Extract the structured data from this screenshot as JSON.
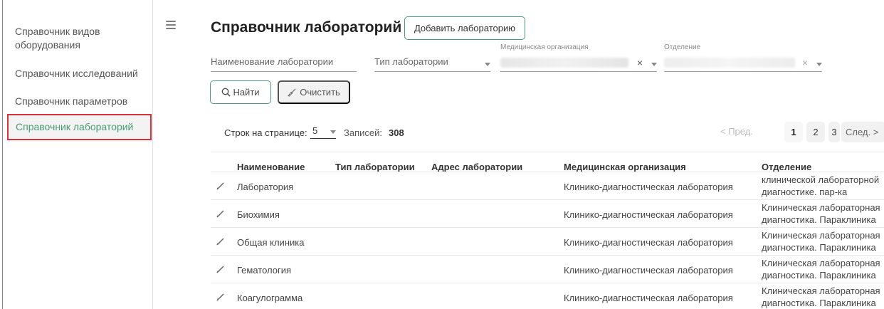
{
  "sidebar": {
    "items": [
      {
        "label": "Справочник видов\nоборудования"
      },
      {
        "label": "Справочник исследований"
      },
      {
        "label": "Справочник параметров"
      },
      {
        "label": "Справочник лабораторий"
      }
    ]
  },
  "header": {
    "title": "Справочник лабораторий",
    "add_button": "Добавить лабораторию"
  },
  "filters": {
    "name_placeholder": "Наименование лаборатории",
    "type_placeholder": "Тип лаборатории",
    "org_label": "Медицинская организация",
    "dept_label": "Отделение",
    "clear_symbol": "×",
    "search_button": "Найти",
    "clear_button": "Очистить"
  },
  "pagination": {
    "rows_label": "Строк на странице:",
    "rows_value": "5",
    "records_label": "Записей:",
    "records_count": "308",
    "prev": "< Пред.",
    "pages": [
      "1",
      "2",
      "3"
    ],
    "next": "След. >"
  },
  "table": {
    "headers": [
      "Наименование",
      "Тип лаборатории",
      "Адрес лаборатории",
      "Медицинская организация",
      "Отделение"
    ],
    "rows": [
      {
        "name": "Лаборатория",
        "org": "Клинико-диагностическая лаборатория",
        "dept": "клинической лабораторной\nдиагностике. пар-ка"
      },
      {
        "name": "Биохимия",
        "org": "Клинико-диагностическая лаборатория",
        "dept": "Клиническая лабораторная\nдиагностика. Параклиника"
      },
      {
        "name": "Общая клиника",
        "org": "Клинико-диагностическая лаборатория",
        "dept": "Клиническая лабораторная\nдиагностика. Параклиника"
      },
      {
        "name": "Гематология",
        "org": "Клинико-диагностическая лаборатория",
        "dept": "Клиническая лабораторная\nдиагностика. Параклиника"
      },
      {
        "name": "Коагулограмма",
        "org": "Клинико-диагностическая лаборатория",
        "dept": "Клиническая лабораторная\nдиагностика. Параклиника"
      }
    ]
  },
  "colors": {
    "accent": "#4a9a77",
    "highlight_border": "#d8313b"
  },
  "icons": {
    "menu": "hamburger-icon",
    "search": "search-icon",
    "clear": "broom-icon",
    "edit": "pencil-icon"
  }
}
